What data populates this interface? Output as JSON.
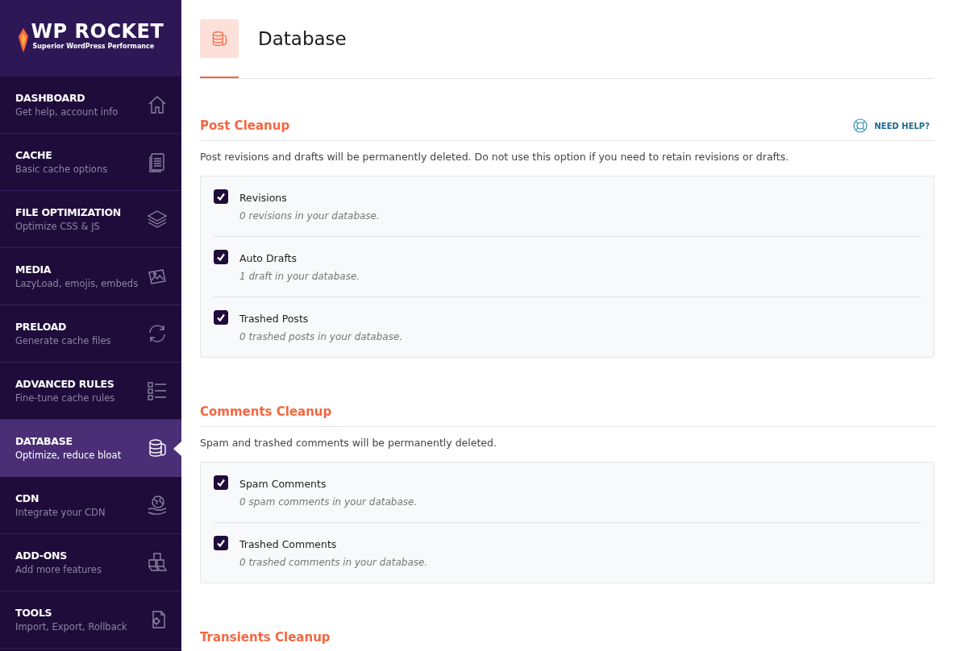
{
  "logo": {
    "name": "WP ROCKET",
    "tagline": "Superior WordPress Performance"
  },
  "nav": [
    {
      "title": "DASHBOARD",
      "subtitle": "Get help, account info",
      "selected": false
    },
    {
      "title": "CACHE",
      "subtitle": "Basic cache options",
      "selected": false
    },
    {
      "title": "FILE OPTIMIZATION",
      "subtitle": "Optimize CSS & JS",
      "selected": false
    },
    {
      "title": "MEDIA",
      "subtitle": "LazyLoad, emojis, embeds",
      "selected": false
    },
    {
      "title": "PRELOAD",
      "subtitle": "Generate cache files",
      "selected": false
    },
    {
      "title": "ADVANCED RULES",
      "subtitle": "Fine-tune cache rules",
      "selected": false
    },
    {
      "title": "DATABASE",
      "subtitle": "Optimize, reduce bloat",
      "selected": true
    },
    {
      "title": "CDN",
      "subtitle": "Integrate your CDN",
      "selected": false
    },
    {
      "title": "ADD-ONS",
      "subtitle": "Add more features",
      "selected": false
    },
    {
      "title": "TOOLS",
      "subtitle": "Import, Export, Rollback",
      "selected": false
    }
  ],
  "page_title": "Database",
  "sections": [
    {
      "title": "Post Cleanup",
      "help": "NEED HELP?",
      "description": "Post revisions and drafts will be permanently deleted. Do not use this option if you need to retain revisions or drafts.",
      "options": [
        {
          "label": "Revisions",
          "note": "0 revisions in your database.",
          "checked": true
        },
        {
          "label": "Auto Drafts",
          "note": "1 draft in your database.",
          "checked": true
        },
        {
          "label": "Trashed Posts",
          "note": "0 trashed posts in your database.",
          "checked": true
        }
      ]
    },
    {
      "title": "Comments Cleanup",
      "description": "Spam and trashed comments will be permanently deleted.",
      "options": [
        {
          "label": "Spam Comments",
          "note": "0 spam comments in your database.",
          "checked": true
        },
        {
          "label": "Trashed Comments",
          "note": "0 trashed comments in your database.",
          "checked": true
        }
      ]
    },
    {
      "title": "Transients Cleanup"
    }
  ]
}
